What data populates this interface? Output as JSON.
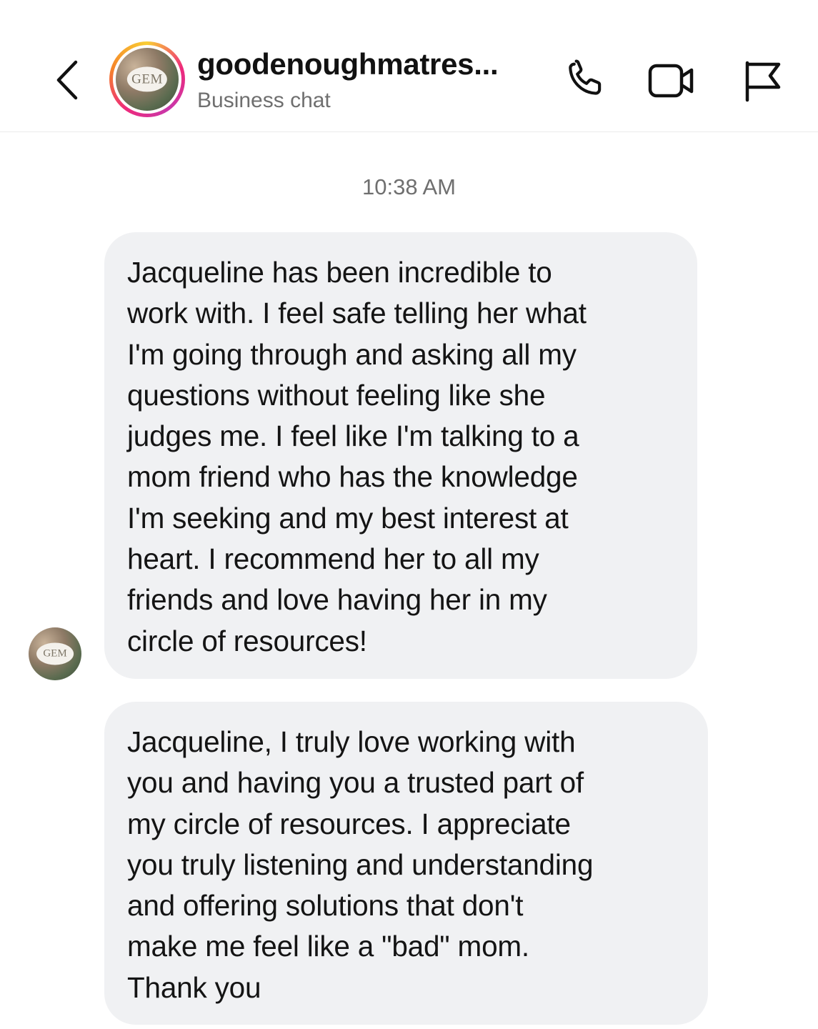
{
  "header": {
    "title": "goodenoughmatres...",
    "subtitle": "Business chat",
    "avatar_text": "GEM",
    "icons": [
      "chevron-left-icon",
      "phone-icon",
      "video-camera-icon",
      "flag-icon"
    ]
  },
  "conversation": {
    "timestamp": "10:38 AM",
    "messages": [
      {
        "sender": "business",
        "avatar_text": "GEM",
        "lines": [
          "Jacqueline has been incredible to",
          "work with. I feel safe telling her what",
          "I'm going through and asking all my",
          "questions without feeling like she",
          "judges me. I feel like I'm talking to a",
          "mom friend who has the knowledge",
          "I'm seeking and my best interest at",
          "heart. I recommend her to all my",
          "friends and love having her in my",
          "circle of resources!"
        ]
      },
      {
        "sender": "business",
        "lines": [
          "Jacqueline, I truly love working with",
          "you and having you a trusted part of",
          "my circle of resources. I appreciate",
          "you truly listening and understanding",
          "and offering solutions that don't",
          "make me feel like a \"bad\" mom.",
          "Thank you"
        ]
      }
    ]
  },
  "colors": {
    "bubble_bg": "#f0f1f3",
    "text": "#111111",
    "muted_text": "#6f6f6f",
    "divider": "#ebebeb"
  }
}
